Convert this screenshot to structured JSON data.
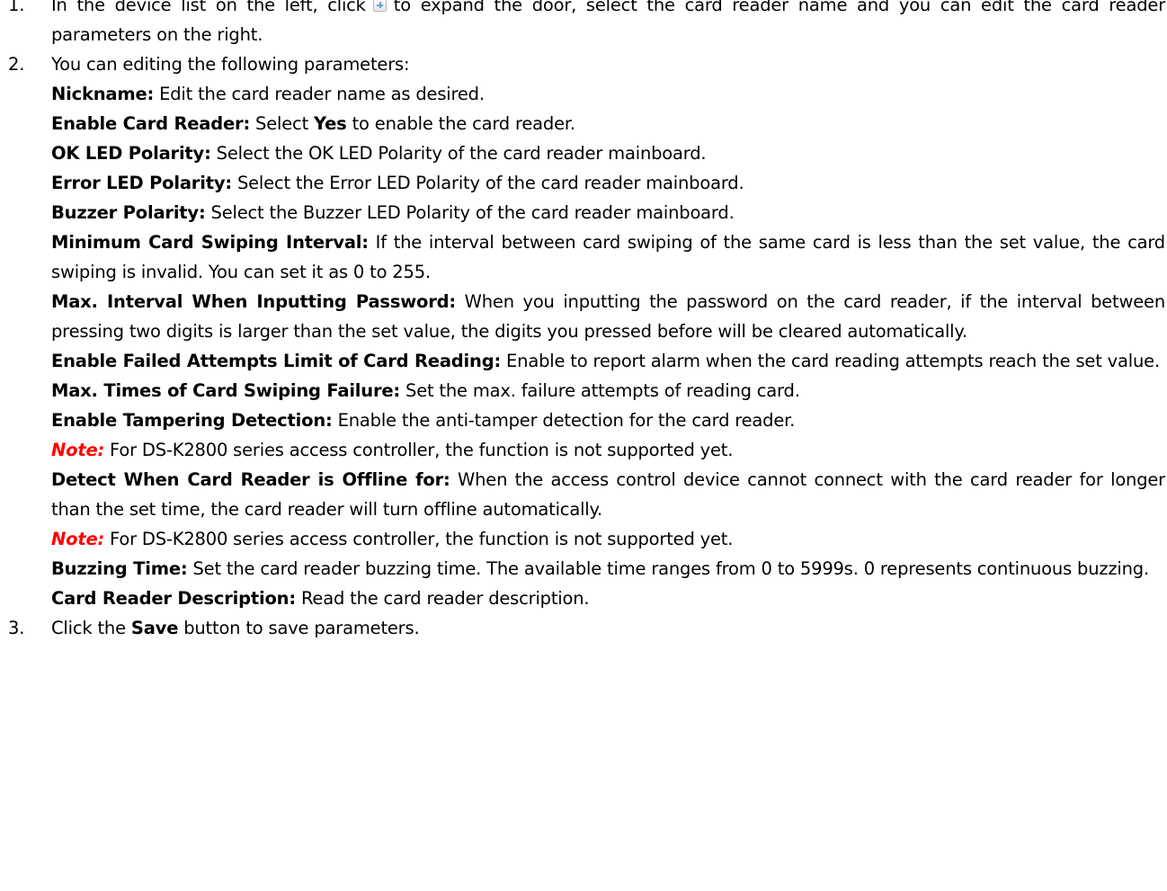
{
  "steps": [
    {
      "number": "1.",
      "text_a": "In the device list on the left, click",
      "icon": "expand-plus-icon",
      "text_b": "to expand the door, select the card reader name and you can edit the card reader parameters on the right."
    },
    {
      "number": "2.",
      "intro": "You can editing the following parameters:",
      "params": [
        {
          "label": "Nickname:",
          "desc": " Edit the card reader name as desired."
        },
        {
          "label": "Enable Card Reader:",
          "desc_a": " Select ",
          "bold": "Yes",
          "desc_b": " to enable the card reader."
        },
        {
          "label": "OK LED Polarity:",
          "desc": " Select the OK LED Polarity of the card reader mainboard."
        },
        {
          "label": "Error LED Polarity:",
          "desc": " Select the Error LED Polarity of the card reader mainboard."
        },
        {
          "label": "Buzzer Polarity:",
          "desc": " Select the Buzzer LED Polarity of the card reader mainboard."
        },
        {
          "label": "Minimum Card Swiping Interval:",
          "desc": " If the interval between card swiping of the same card is less than the set value, the card swiping is invalid. You can set it as 0 to 255."
        },
        {
          "label": "Max. Interval When Inputting Password:",
          "desc": " When you inputting the password on the card reader, if the interval between pressing two digits is larger than the set value, the digits you pressed before will be cleared automatically."
        },
        {
          "label": "Enable Failed Attempts Limit of Card Reading:",
          "desc": " Enable to report alarm when the card reading attempts reach the set value."
        },
        {
          "label": "Max. Times of Card Swiping Failure:",
          "desc": " Set the max. failure attempts of reading card."
        },
        {
          "label": "Enable Tampering Detection:",
          "desc": " Enable the anti-tamper detection for the card reader."
        },
        {
          "note_label": "Note:",
          "desc": " For DS-K2800 series access controller, the function is not supported yet."
        },
        {
          "label": "Detect When Card Reader is Offline for:",
          "desc": " When the access control device cannot connect with the card reader for longer than the set time, the card reader will turn offline automatically."
        },
        {
          "note_label": "Note:",
          "desc": " For DS-K2800 series access controller, the function is not supported yet."
        },
        {
          "label": "Buzzing Time:",
          "desc": " Set the card reader buzzing time. The available time ranges from 0 to 5999s. 0 represents continuous buzzing."
        },
        {
          "label": "Card Reader Description:",
          "desc": " Read the card reader description."
        }
      ]
    },
    {
      "number": "3.",
      "text_a": "Click the ",
      "bold": "Save",
      "text_b": " button to save parameters."
    }
  ]
}
